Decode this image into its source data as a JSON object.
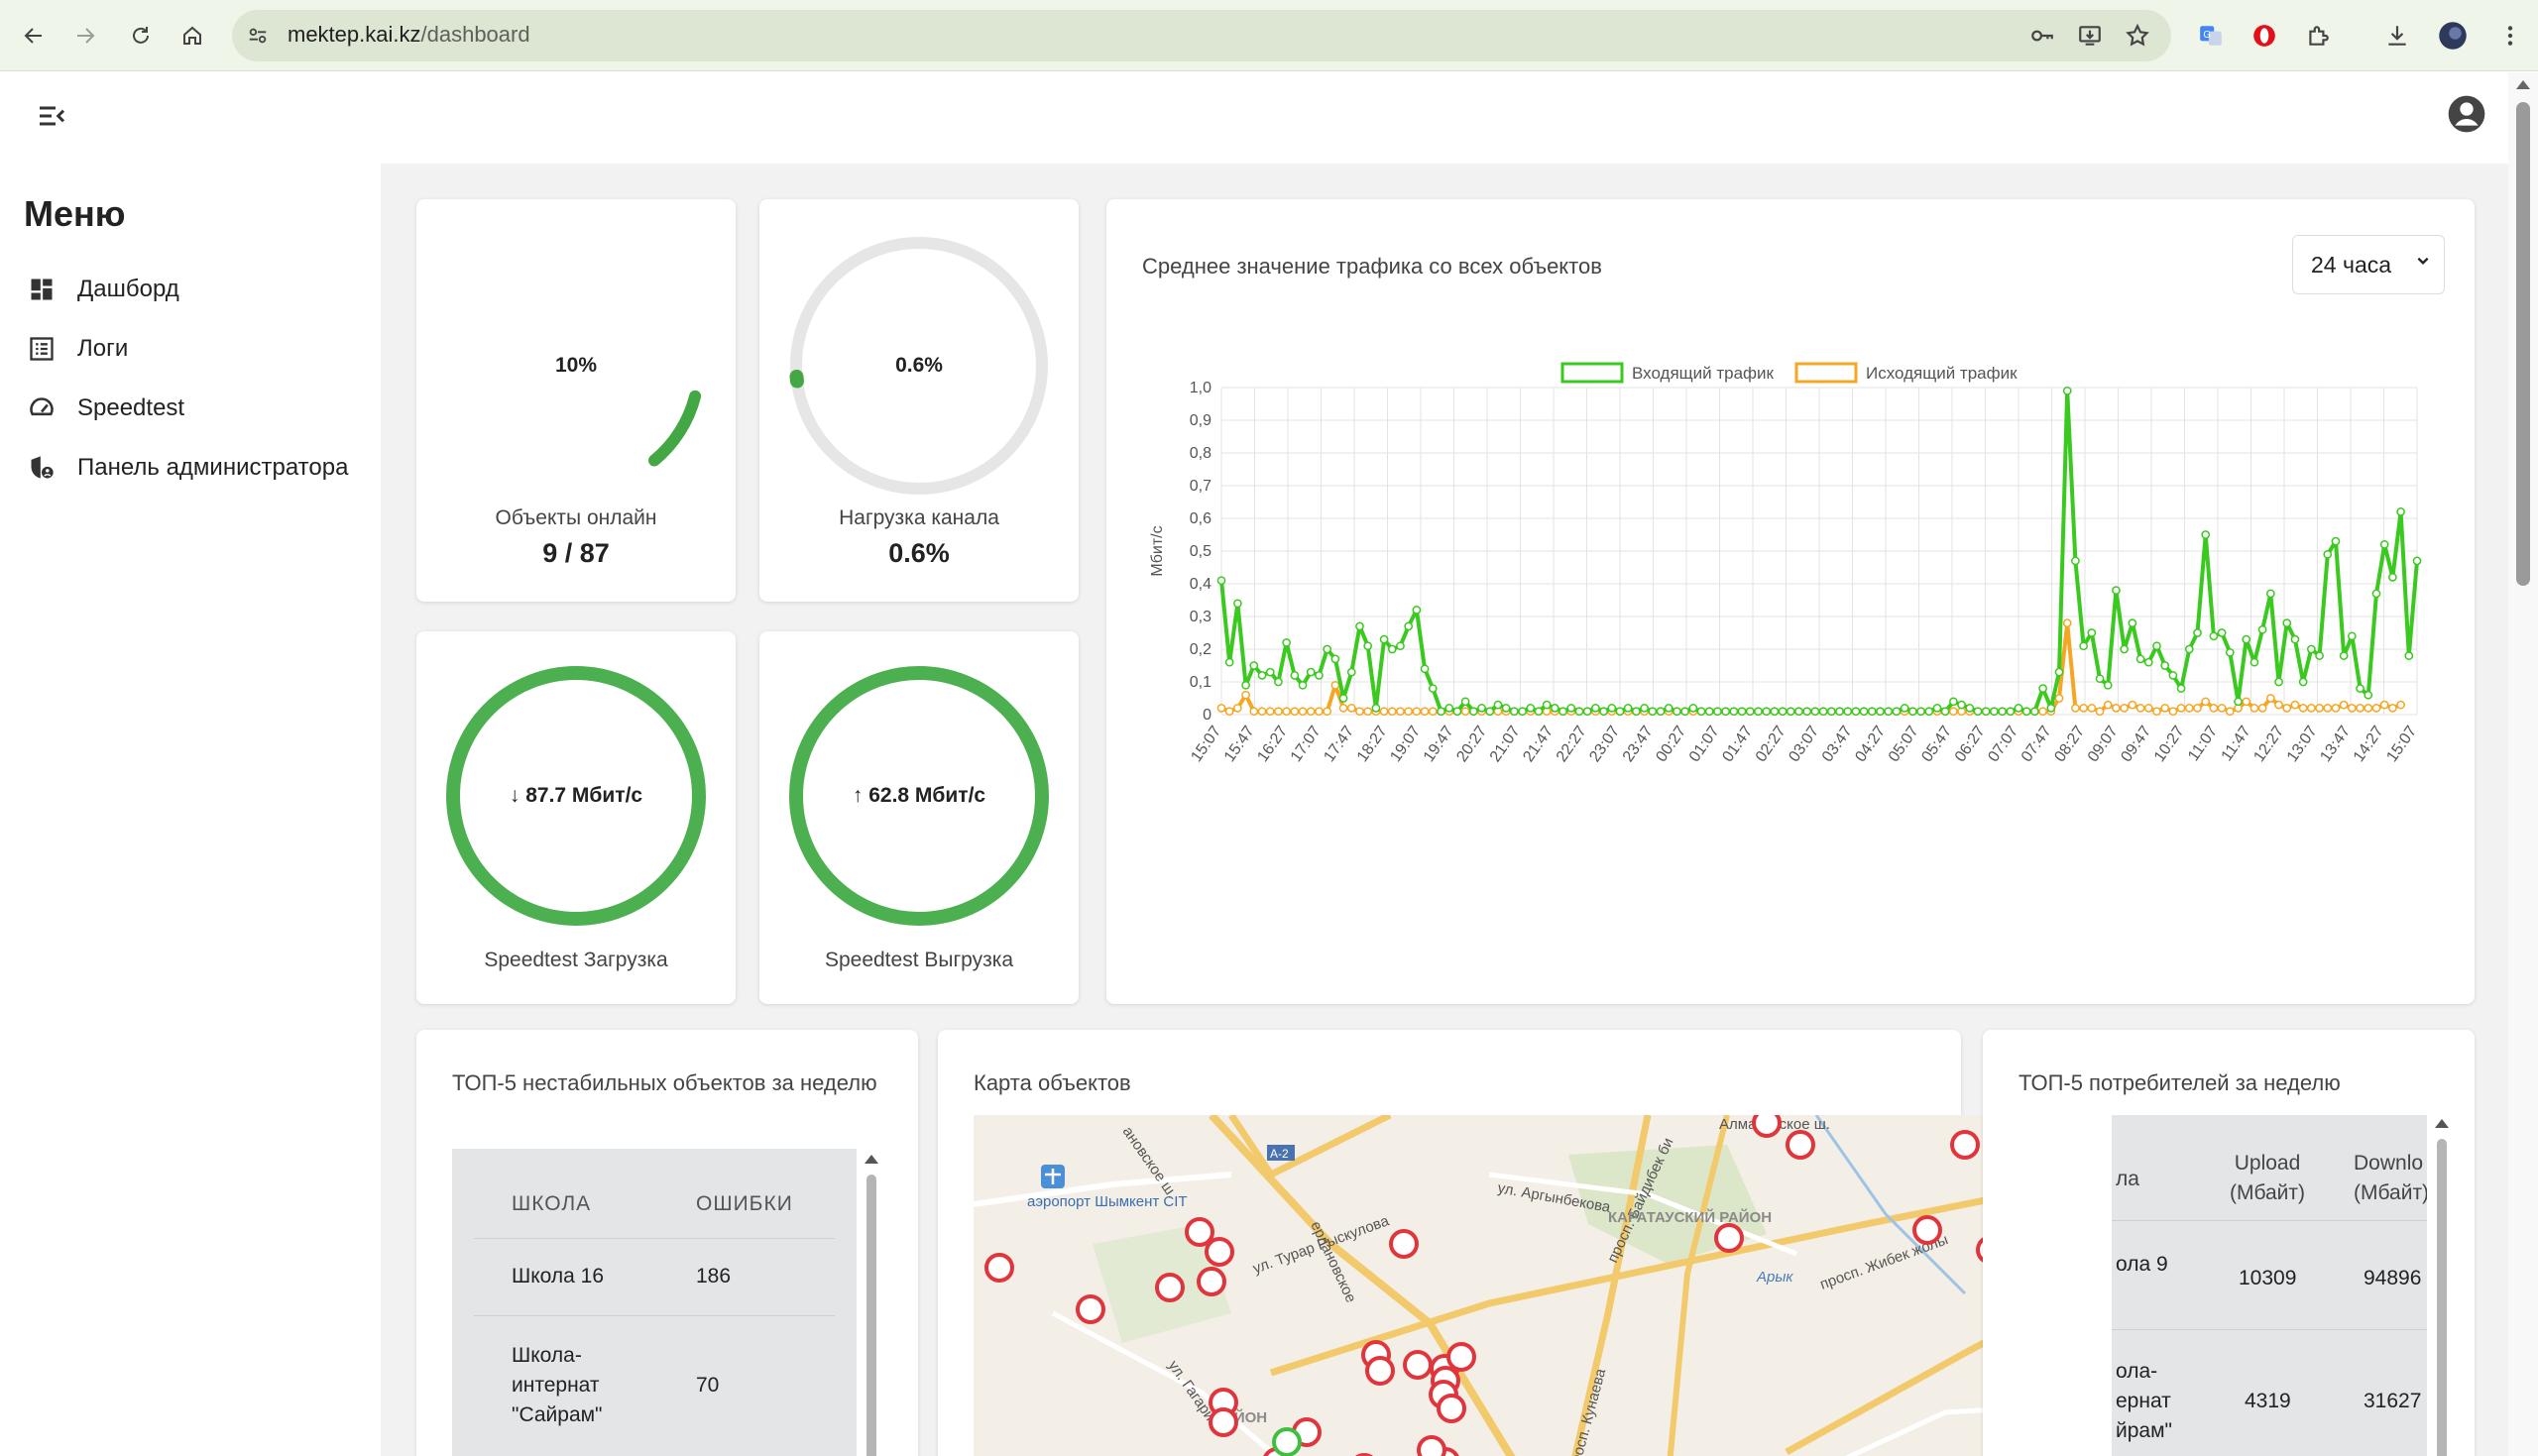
{
  "browser": {
    "url_host": "mektep.kai.kz",
    "url_path": "/dashboard"
  },
  "sidebar": {
    "title": "Меню",
    "items": [
      {
        "label": "Дашборд",
        "icon": "dashboard-icon"
      },
      {
        "label": "Логи",
        "icon": "list-icon"
      },
      {
        "label": "Speedtest",
        "icon": "speedometer-icon"
      },
      {
        "label": "Панель администратора",
        "icon": "admin-shield-icon"
      }
    ]
  },
  "cards": {
    "online": {
      "gauge_text": "10%",
      "label": "Объекты онлайн",
      "value": "9 / 87",
      "fraction": 0.1,
      "color": "#43a843"
    },
    "load": {
      "gauge_text": "0.6%",
      "label": "Нагрузка канала",
      "value": "0.6%",
      "fraction": 0.006,
      "color": "#43a843"
    },
    "download": {
      "gauge_text": "↓ 87.7 Мбит/с",
      "label": "Speedtest Загрузка",
      "fraction": 1.0,
      "color": "#4caf50"
    },
    "upload": {
      "gauge_text": "↑ 62.8 Мбит/с",
      "label": "Speedtest Выгрузка",
      "fraction": 1.0,
      "color": "#4caf50"
    }
  },
  "traffic": {
    "title": "Среднее значение трафика со всех объектов",
    "range_select": "24 часа"
  },
  "chart_data": {
    "type": "line",
    "ylabel": "Мбит/с",
    "xlabel": "",
    "ylim": [
      0,
      1.0
    ],
    "yticks": [
      "1,0",
      "0,9",
      "0,8",
      "0,7",
      "0,6",
      "0,5",
      "0,4",
      "0,3",
      "0,2",
      "0,1",
      "0"
    ],
    "xticks": [
      "15:07",
      "15:47",
      "16:27",
      "17:07",
      "17:47",
      "18:27",
      "19:07",
      "19:47",
      "20:27",
      "21:07",
      "21:47",
      "22:27",
      "23:07",
      "23:47",
      "00:27",
      "01:07",
      "01:47",
      "02:27",
      "03:07",
      "03:47",
      "04:27",
      "05:07",
      "05:47",
      "06:27",
      "07:07",
      "07:47",
      "08:27",
      "09:07",
      "09:47",
      "10:27",
      "11:07",
      "11:47",
      "12:27",
      "13:07",
      "13:47",
      "14:27",
      "15:07"
    ],
    "legend_position": "top",
    "grid": true,
    "series": [
      {
        "name": "Входящий трафик",
        "color": "#3ac91e",
        "values": [
          0.41,
          0.16,
          0.34,
          0.09,
          0.15,
          0.12,
          0.13,
          0.1,
          0.22,
          0.12,
          0.09,
          0.13,
          0.12,
          0.2,
          0.17,
          0.05,
          0.13,
          0.27,
          0.21,
          0.02,
          0.23,
          0.2,
          0.21,
          0.27,
          0.32,
          0.14,
          0.08,
          0.01,
          0.02,
          0.01,
          0.04,
          0.01,
          0.02,
          0.01,
          0.03,
          0.02,
          0.01,
          0.01,
          0.02,
          0.01,
          0.03,
          0.02,
          0.01,
          0.02,
          0.01,
          0.01,
          0.02,
          0.01,
          0.02,
          0.01,
          0.02,
          0.01,
          0.02,
          0.01,
          0.01,
          0.02,
          0.01,
          0.01,
          0.02,
          0.01,
          0.01,
          0.01,
          0.01,
          0.01,
          0.01,
          0.01,
          0.01,
          0.01,
          0.01,
          0.01,
          0.01,
          0.01,
          0.01,
          0.01,
          0.01,
          0.01,
          0.01,
          0.01,
          0.01,
          0.01,
          0.01,
          0.01,
          0.01,
          0.01,
          0.02,
          0.01,
          0.01,
          0.01,
          0.02,
          0.01,
          0.04,
          0.03,
          0.02,
          0.01,
          0.01,
          0.01,
          0.01,
          0.01,
          0.02,
          0.01,
          0.01,
          0.08,
          0.02,
          0.13,
          0.99,
          0.47,
          0.21,
          0.25,
          0.11,
          0.09,
          0.38,
          0.2,
          0.28,
          0.17,
          0.16,
          0.21,
          0.15,
          0.12,
          0.08,
          0.2,
          0.25,
          0.55,
          0.24,
          0.25,
          0.19,
          0.04,
          0.23,
          0.16,
          0.26,
          0.37,
          0.1,
          0.28,
          0.23,
          0.1,
          0.2,
          0.18,
          0.49,
          0.53,
          0.18,
          0.24,
          0.08,
          0.06,
          0.37,
          0.52,
          0.42,
          0.62,
          0.18,
          0.47
        ]
      },
      {
        "name": "Исходящий трафик",
        "color": "#f5a623",
        "values": [
          0.02,
          0.01,
          0.02,
          0.06,
          0.01,
          0.01,
          0.01,
          0.01,
          0.01,
          0.01,
          0.01,
          0.01,
          0.01,
          0.01,
          0.09,
          0.02,
          0.02,
          0.01,
          0.01,
          0.01,
          0.01,
          0.01,
          0.01,
          0.01,
          0.01,
          0.01,
          0.01,
          0.01,
          0.01,
          0.01,
          0.01,
          0.01,
          0.01,
          0.01,
          0.01,
          0.01,
          0.01,
          0.01,
          0.01,
          0.01,
          0.01,
          0.01,
          0.01,
          0.01,
          0.01,
          0.01,
          0.01,
          0.01,
          0.01,
          0.01,
          0.01,
          0.01,
          0.01,
          0.01,
          0.01,
          0.01,
          0.01,
          0.01,
          0.01,
          0.01,
          0.01,
          0.01,
          0.01,
          0.01,
          0.01,
          0.01,
          0.01,
          0.01,
          0.01,
          0.01,
          0.01,
          0.01,
          0.01,
          0.01,
          0.01,
          0.01,
          0.01,
          0.01,
          0.01,
          0.01,
          0.01,
          0.01,
          0.01,
          0.01,
          0.01,
          0.01,
          0.01,
          0.01,
          0.01,
          0.01,
          0.01,
          0.01,
          0.01,
          0.01,
          0.01,
          0.01,
          0.01,
          0.01,
          0.01,
          0.01,
          0.01,
          0.01,
          0.01,
          0.05,
          0.28,
          0.02,
          0.02,
          0.02,
          0.01,
          0.03,
          0.02,
          0.02,
          0.03,
          0.02,
          0.02,
          0.01,
          0.02,
          0.01,
          0.02,
          0.02,
          0.02,
          0.04,
          0.02,
          0.02,
          0.01,
          0.02,
          0.04,
          0.02,
          0.02,
          0.05,
          0.03,
          0.02,
          0.03,
          0.02,
          0.02,
          0.02,
          0.02,
          0.02,
          0.03,
          0.02,
          0.02,
          0.02,
          0.02,
          0.03,
          0.02,
          0.03
        ]
      }
    ]
  },
  "unstable": {
    "title": "ТОП-5 нестабильных объектов за неделю",
    "columns": [
      "ШКОЛА",
      "ОШИБКИ"
    ],
    "rows": [
      {
        "school": "Школа 16",
        "errors": "186"
      },
      {
        "school": "Школа-интернат \"Сайрам\"",
        "errors": "70"
      }
    ]
  },
  "map": {
    "title": "Карта объектов",
    "labels": {
      "airport": "аэропорт Шымкент CIT",
      "road_a2": "A-2",
      "almatinskoe": "Алматинское ш.",
      "argynbekova": "ул. Аргынбекова",
      "baidibek": "просп. Байдибек би",
      "karatau": "КАРАТАУСКИЙ РАЙОН",
      "arys": "Арык",
      "turar": "ул. Турар Рыскулова",
      "zhibek": "просп. Жибек жолы",
      "kunaeva": "просп. Кунаева",
      "gagarina": "ул. Гагарина",
      "district": "АЙОН",
      "tashkent": "ановское ш.",
      "erlanovskoe": "ерлановское"
    }
  },
  "consumers": {
    "title": "ТОП-5 потребителей за неделю",
    "columns": [
      "ла",
      "Upload (Мбайт)",
      "Downlo (Мбайт)"
    ],
    "rows": [
      {
        "school": "ола 9",
        "upload": "10309",
        "download": "94896"
      },
      {
        "school": "ола-ернат йрам\"",
        "upload": "4319",
        "download": "31627"
      }
    ]
  }
}
